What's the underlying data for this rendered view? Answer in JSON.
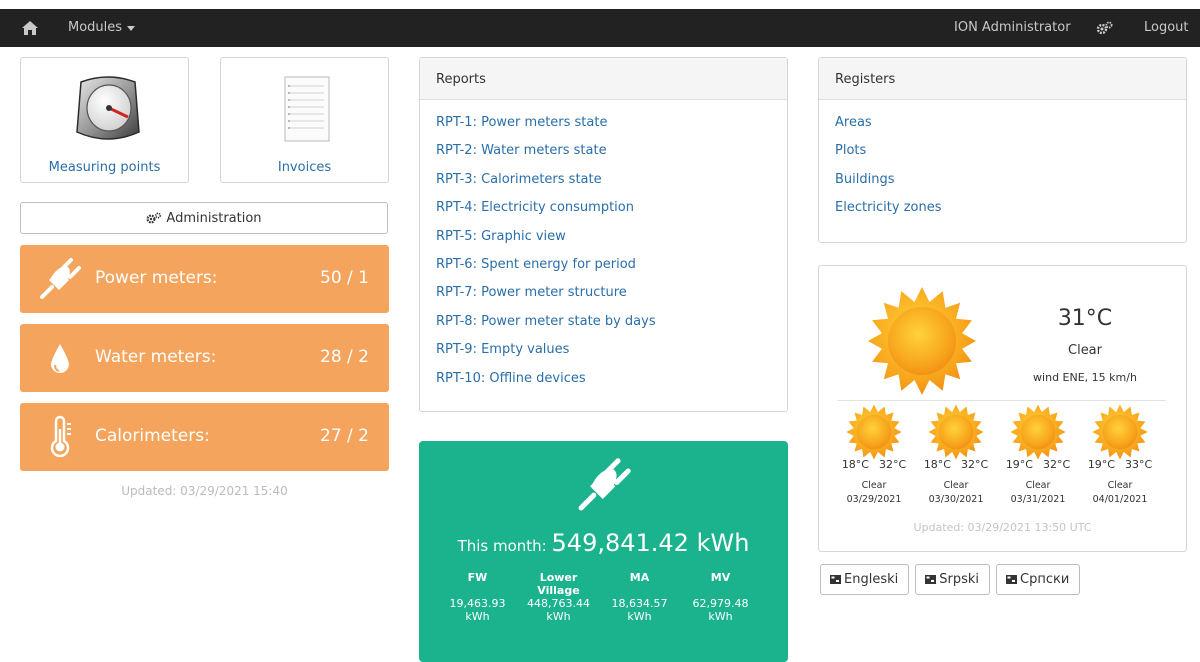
{
  "nav": {
    "modules_label": "Modules",
    "user_label": "ION Administrator",
    "logout_label": "Logout"
  },
  "tiles": {
    "measuring_points": "Measuring points",
    "invoices": "Invoices"
  },
  "administration_label": "Administration",
  "meters": [
    {
      "label": "Power meters:",
      "value": "50 / 1",
      "icon": "plug-icon"
    },
    {
      "label": "Water meters:",
      "value": "28 / 2",
      "icon": "water-drop-icon"
    },
    {
      "label": "Calorimeters:",
      "value": "27 / 2",
      "icon": "thermometer-icon"
    }
  ],
  "meters_updated": "Updated: 03/29/2021 15:40",
  "reports": {
    "title": "Reports",
    "items": [
      "RPT-1: Power meters state",
      "RPT-2: Water meters state",
      "RPT-3: Calorimeters state",
      "RPT-4: Electricity consumption",
      "RPT-5: Graphic view",
      "RPT-6: Spent energy for period",
      "RPT-7: Power meter structure",
      "RPT-8: Power meter state by days",
      "RPT-9: Empty values",
      "RPT-10: Offline devices"
    ]
  },
  "energy": {
    "month_label": "This month:",
    "month_value": "549,841.42 kWh",
    "zones": [
      {
        "name": "FW",
        "value": "19,463.93",
        "unit": "kWh"
      },
      {
        "name": "Lower Village",
        "value": "448,763.44",
        "unit": "kWh"
      },
      {
        "name": "MA",
        "value": "18,634.57",
        "unit": "kWh"
      },
      {
        "name": "MV",
        "value": "62,979.48",
        "unit": "kWh"
      }
    ]
  },
  "registers": {
    "title": "Registers",
    "items": [
      "Areas",
      "Plots",
      "Buildings",
      "Electricity zones"
    ]
  },
  "weather": {
    "temperature": "31°C",
    "condition": "Clear",
    "wind": "wind ENE, 15 km/h",
    "forecast": [
      {
        "low": "18°C",
        "high": "32°C",
        "condition": "Clear",
        "date": "03/29/2021"
      },
      {
        "low": "18°C",
        "high": "32°C",
        "condition": "Clear",
        "date": "03/30/2021"
      },
      {
        "low": "19°C",
        "high": "32°C",
        "condition": "Clear",
        "date": "03/31/2021"
      },
      {
        "low": "19°C",
        "high": "33°C",
        "condition": "Clear",
        "date": "04/01/2021"
      }
    ],
    "updated": "Updated: 03/29/2021 13:50 UTC"
  },
  "languages": [
    "Engleski",
    "Srpski",
    "Српски"
  ],
  "colors": {
    "topbar": "#222222",
    "meter_tile": "#f4a45c",
    "energy_panel": "#1bb28e",
    "link": "#2a6eaa"
  }
}
